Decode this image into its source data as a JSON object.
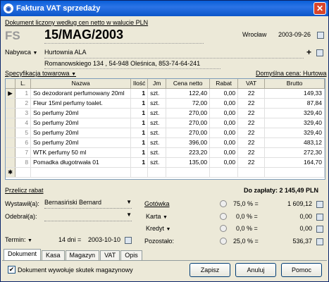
{
  "window": {
    "title": "Faktura VAT sprzedaży",
    "close": "✕"
  },
  "info_link": "Dokument liczony według cen netto w walucie PLN",
  "doc": {
    "type": "FS",
    "number": "15/MAG/2003",
    "place_label": "Wrocław",
    "date": "2003-09-26"
  },
  "buyer": {
    "label": "Nabywca",
    "name": "Hurtownia ALA",
    "address": "Romanowskiego 134 , 54-948 Oleśnica, 853-74-64-241",
    "plus": "+"
  },
  "spec": {
    "label": "Specyfikacja towarowa",
    "price_label": "Domyślna cena: Hurtowa"
  },
  "table": {
    "headers": [
      "L.",
      "Nazwa",
      "Ilość",
      "Jm",
      "Cena netto",
      "Rabat",
      "VAT",
      "Brutto"
    ],
    "rows": [
      {
        "lp": "1",
        "name": "So dezodorant perfumowany 20ml",
        "qty": "1",
        "jm": "szt.",
        "price": "122,40",
        "discount": "0,00",
        "vat": "22",
        "gross": "149,33"
      },
      {
        "lp": "2",
        "name": "Fleur 15ml perfumy toalet.",
        "qty": "1",
        "jm": "szt.",
        "price": "72,00",
        "discount": "0,00",
        "vat": "22",
        "gross": "87,84"
      },
      {
        "lp": "3",
        "name": "So perfumy 20ml",
        "qty": "1",
        "jm": "szt.",
        "price": "270,00",
        "discount": "0,00",
        "vat": "22",
        "gross": "329,40"
      },
      {
        "lp": "4",
        "name": "So perfumy 20ml",
        "qty": "1",
        "jm": "szt.",
        "price": "270,00",
        "discount": "0,00",
        "vat": "22",
        "gross": "329,40"
      },
      {
        "lp": "5",
        "name": "So perfumy 20ml",
        "qty": "1",
        "jm": "szt.",
        "price": "270,00",
        "discount": "0,00",
        "vat": "22",
        "gross": "329,40"
      },
      {
        "lp": "6",
        "name": "So perfumy 20ml",
        "qty": "1",
        "jm": "szt.",
        "price": "396,00",
        "discount": "0,00",
        "vat": "22",
        "gross": "483,12"
      },
      {
        "lp": "7",
        "name": "WTK perfumy 50 ml",
        "qty": "1",
        "jm": "szt.",
        "price": "223,20",
        "discount": "0,00",
        "vat": "22",
        "gross": "272,30"
      },
      {
        "lp": "8",
        "name": "Pomadka długotrwała 01",
        "qty": "1",
        "jm": "szt.",
        "price": "135,00",
        "discount": "0,00",
        "vat": "22",
        "gross": "164,70"
      }
    ],
    "new_row": "✱",
    "current_marker": "▶"
  },
  "recalc": "Przelicz rabat",
  "total": "Do zapłaty: 2 145,49 PLN",
  "issued_by": {
    "label": "Wystawił(a):",
    "value": "Bernasiński Bernard"
  },
  "received_by": {
    "label": "Odebrał(a):",
    "value": ""
  },
  "term": {
    "label": "Termin:",
    "days": "14 dni",
    "eq": "=",
    "date": "2003-10-10"
  },
  "payments": [
    {
      "label": "Gotówka",
      "percent": "75,0 %",
      "eq": "=",
      "amount": "1 609,12"
    },
    {
      "label": "Karta",
      "percent": "0,0 %",
      "eq": "=",
      "amount": "0,00"
    },
    {
      "label": "Kredyt",
      "percent": "0,0 %",
      "eq": "=",
      "amount": "0,00"
    },
    {
      "label": "Pozostało:",
      "percent": "25,0 %",
      "eq": "=",
      "amount": "536,37"
    }
  ],
  "tabs": [
    "Dokument",
    "Kasa",
    "Magazyn",
    "VAT",
    "Opis"
  ],
  "checkbox": {
    "label": "Dokument wywołuje skutek magazynowy",
    "checked": "✔"
  },
  "buttons": {
    "save": "Zapisz",
    "cancel": "Anuluj",
    "help": "Pomoc"
  },
  "arrow": "▼",
  "colors": {
    "title_bar": "#0b55c8",
    "close": "#d8442a"
  }
}
